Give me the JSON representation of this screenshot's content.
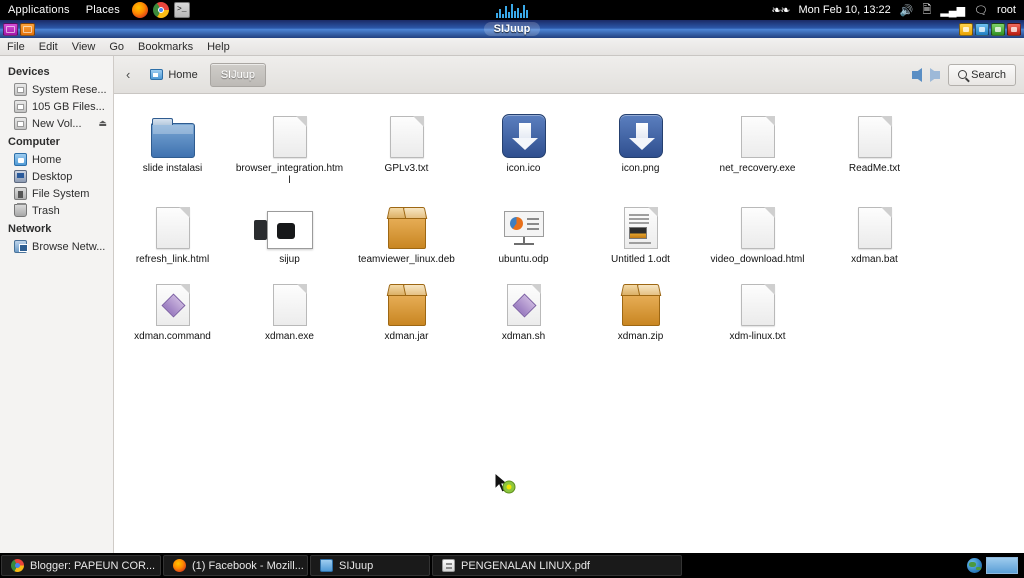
{
  "top_panel": {
    "menus": [
      "Applications",
      "Places"
    ],
    "launchers": [
      {
        "name": "firefox-icon",
        "label": "Firefox"
      },
      {
        "name": "chrome-icon",
        "label": "Chrome"
      },
      {
        "name": "terminal-icon",
        "label": ">_"
      }
    ],
    "clock": "Mon Feb 10, 13:22",
    "user": "root",
    "tray": [
      "volume-icon",
      "battery-icon",
      "network-signal-icon",
      "chat-icon"
    ]
  },
  "window": {
    "title": "SIJuup",
    "controls": [
      "minimize",
      "shade",
      "maximize",
      "close"
    ]
  },
  "menubar": [
    "File",
    "Edit",
    "View",
    "Go",
    "Bookmarks",
    "Help"
  ],
  "sidebar": {
    "sections": [
      {
        "heading": "Devices",
        "items": [
          {
            "label": "System Rese...",
            "icon": "drive-icon",
            "eject": false
          },
          {
            "label": "105 GB Files...",
            "icon": "drive-icon",
            "eject": false
          },
          {
            "label": "New Vol...",
            "icon": "drive-icon",
            "eject": true
          }
        ]
      },
      {
        "heading": "Computer",
        "items": [
          {
            "label": "Home",
            "icon": "home-icon",
            "eject": false
          },
          {
            "label": "Desktop",
            "icon": "desktop-icon",
            "eject": false
          },
          {
            "label": "File System",
            "icon": "filesystem-icon",
            "eject": false
          },
          {
            "label": "Trash",
            "icon": "trash-icon",
            "eject": false
          }
        ]
      },
      {
        "heading": "Network",
        "items": [
          {
            "label": "Browse Netw...",
            "icon": "network-icon",
            "eject": false
          }
        ]
      }
    ]
  },
  "pathbar": {
    "back_label": "‹",
    "crumbs": [
      {
        "label": "Home",
        "active": false
      },
      {
        "label": "SIJuup",
        "active": true
      }
    ],
    "search_label": "Search"
  },
  "files": [
    [
      {
        "name": "slide instalasi",
        "type": "folder"
      },
      {
        "name": "browser_integration.html",
        "type": "doc"
      },
      {
        "name": "GPLv3.txt",
        "type": "doc"
      },
      {
        "name": "icon.ico",
        "type": "download"
      },
      {
        "name": "icon.png",
        "type": "download"
      },
      {
        "name": "net_recovery.exe",
        "type": "wine"
      },
      {
        "name": "ReadMe.txt",
        "type": "doc"
      }
    ],
    [
      {
        "name": "refresh_link.html",
        "type": "doc"
      },
      {
        "name": "sijup",
        "type": "photo"
      },
      {
        "name": "teamviewer_linux.deb",
        "type": "package"
      },
      {
        "name": "ubuntu.odp",
        "type": "presentation"
      },
      {
        "name": "Untitled 1.odt",
        "type": "odt"
      },
      {
        "name": "video_download.html",
        "type": "doc"
      },
      {
        "name": "xdman.bat",
        "type": "doc"
      }
    ],
    [
      {
        "name": "xdman.command",
        "type": "script"
      },
      {
        "name": "xdman.exe",
        "type": "wine"
      },
      {
        "name": "xdman.jar",
        "type": "package"
      },
      {
        "name": "xdman.sh",
        "type": "script"
      },
      {
        "name": "xdman.zip",
        "type": "package"
      },
      {
        "name": "xdm-linux.txt",
        "type": "doc"
      }
    ]
  ],
  "taskbar": {
    "items": [
      {
        "label": "Blogger: PAPEUN COR...",
        "icon": "chrome-icon"
      },
      {
        "label": "(1) Facebook - Mozill...",
        "icon": "firefox-icon"
      },
      {
        "label": "SIJuup",
        "icon": "folder-icon"
      },
      {
        "label": "PENGENALAN LINUX.pdf",
        "icon": "pdf-icon"
      }
    ],
    "tray": [
      "globe-icon"
    ],
    "workspaces": 1
  },
  "colors": {
    "titlebar": "#2c57a8",
    "accent_folder": "#3f72b0",
    "download_badge": "#2f4f8f",
    "panel_bg": "#000000"
  }
}
